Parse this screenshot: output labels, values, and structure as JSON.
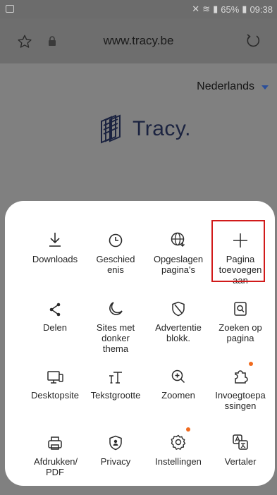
{
  "status_bar": {
    "battery": "65%",
    "time": "09:38"
  },
  "browser": {
    "url": "www.tracy.be"
  },
  "page": {
    "language": "Nederlands",
    "brand": "Tracy",
    "brand_dot": "."
  },
  "menu": {
    "items": [
      {
        "label": "Downloads",
        "icon": "download-icon"
      },
      {
        "label": "Geschiedenis",
        "icon": "history-icon"
      },
      {
        "label": "Opgeslagen pagina's",
        "icon": "saved-pages-icon"
      },
      {
        "label": "Pagina toevoegen aan",
        "icon": "plus-icon"
      },
      {
        "label": "Delen",
        "icon": "share-icon"
      },
      {
        "label": "Sites met donker thema",
        "icon": "moon-icon"
      },
      {
        "label": "Advertentie blokk.",
        "icon": "ad-block-icon"
      },
      {
        "label": "Zoeken op pagina",
        "icon": "find-in-page-icon"
      },
      {
        "label": "Desktopsite",
        "icon": "desktop-icon"
      },
      {
        "label": "Tekstgrootte",
        "icon": "text-size-icon"
      },
      {
        "label": "Zoomen",
        "icon": "zoom-icon"
      },
      {
        "label": "Invoegtoepassingen",
        "icon": "add-ons-icon"
      },
      {
        "label": "Afdrukken/ PDF",
        "icon": "print-icon"
      },
      {
        "label": "Privacy",
        "icon": "privacy-icon"
      },
      {
        "label": "Instellingen",
        "icon": "settings-icon"
      },
      {
        "label": "Vertaler",
        "icon": "translate-icon"
      }
    ]
  },
  "colors": {
    "badge": "#f06a1e",
    "highlight": "#d11a1a",
    "accent": "#2b4f9a"
  }
}
